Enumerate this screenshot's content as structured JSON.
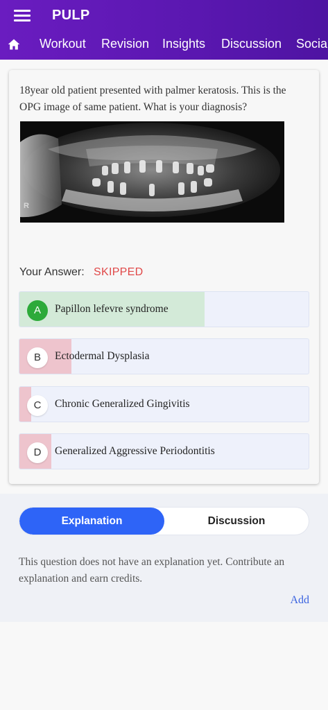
{
  "app": {
    "title": "PULP"
  },
  "nav": {
    "tabs": [
      "Workout",
      "Revision",
      "Insights",
      "Discussion",
      "Social"
    ]
  },
  "question": {
    "text": "18year old patient presented with palmer keratosis. This is the OPG image of same patient. What is your diagnosis?",
    "image_marker": "R"
  },
  "answer": {
    "label": "Your Answer:",
    "value": "SKIPPED"
  },
  "options": [
    {
      "letter": "A",
      "text": "Papillon lefevre syndrome",
      "share": 0.64,
      "correct": true
    },
    {
      "letter": "B",
      "text": "Ectodermal Dysplasia",
      "share": 0.18,
      "correct": false
    },
    {
      "letter": "C",
      "text": "Chronic Generalized Gingivitis",
      "share": 0.04,
      "correct": false
    },
    {
      "letter": "D",
      "text": "Generalized Aggressive Periodontitis",
      "share": 0.11,
      "correct": false
    }
  ],
  "colors": {
    "header": "#5a17b0",
    "correct_fill": "#d3ead8",
    "wrong_fill": "#eec4cd",
    "skipped": "#e04848",
    "accent": "#2e64f7"
  },
  "explanation": {
    "tabs": {
      "active": "Explanation",
      "inactive": "Discussion"
    },
    "text": "This question does not have an explanation yet. Contribute an explanation and earn credits.",
    "add_label": "Add"
  }
}
